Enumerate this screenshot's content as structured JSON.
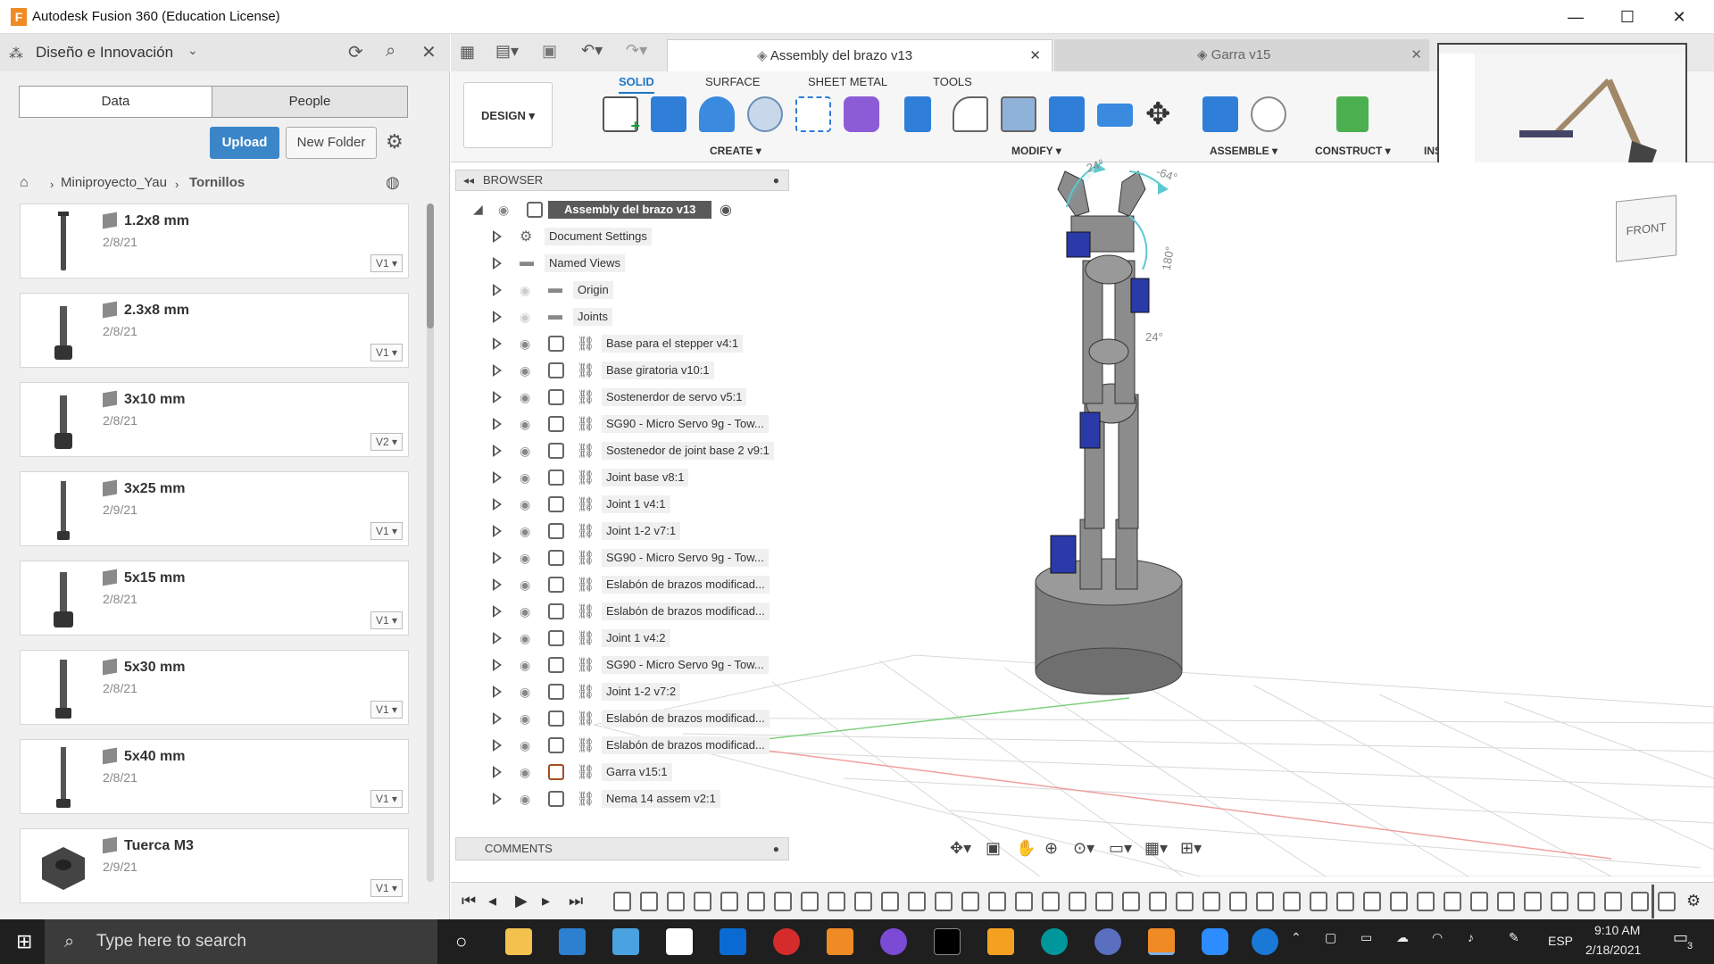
{
  "window": {
    "title": "Autodesk Fusion 360 (Education License)",
    "app_icon": "F",
    "controls": {
      "minimize": "—",
      "maximize": "☐",
      "close": "✕"
    }
  },
  "data_panel": {
    "hub": "Diseño e Innovación",
    "tabs": [
      "Data",
      "People"
    ],
    "upload_label": "Upload",
    "new_folder_label": "New Folder",
    "breadcrumb": [
      "Miniproyecto_Yau",
      "Tornillos"
    ],
    "files": [
      {
        "name": "1.2x8 mm",
        "date": "2/8/21",
        "version": "V1"
      },
      {
        "name": "2.3x8 mm",
        "date": "2/8/21",
        "version": "V1"
      },
      {
        "name": "3x10 mm",
        "date": "2/8/21",
        "version": "V2"
      },
      {
        "name": "3x25 mm",
        "date": "2/9/21",
        "version": "V1"
      },
      {
        "name": "5x15 mm",
        "date": "2/8/21",
        "version": "V1"
      },
      {
        "name": "5x30 mm",
        "date": "2/8/21",
        "version": "V1"
      },
      {
        "name": "5x40 mm",
        "date": "2/8/21",
        "version": "V1"
      },
      {
        "name": "Tuerca M3",
        "date": "2/9/21",
        "version": "V1"
      }
    ]
  },
  "doc_tabs": [
    {
      "label": "Assembly del brazo v13",
      "active": true
    },
    {
      "label": "Garra v15",
      "active": false
    }
  ],
  "ribbon": {
    "workspace": "DESIGN",
    "tabs": [
      "SOLID",
      "SURFACE",
      "SHEET METAL",
      "TOOLS"
    ],
    "groups": [
      "CREATE",
      "MODIFY",
      "ASSEMBLE",
      "CONSTRUCT",
      "INS"
    ]
  },
  "browser": {
    "header": "BROWSER",
    "root": "Assembly del brazo v13",
    "items": [
      "Document Settings",
      "Named Views",
      "Origin",
      "Joints",
      "Base para el stepper v4:1",
      "Base giratoria v10:1",
      "Sostenerdor de servo v5:1",
      "SG90 - Micro Servo 9g - Tow...",
      "Sostenedor de joint base 2 v9:1",
      "Joint base v8:1",
      "Joint 1 v4:1",
      "Joint 1-2 v7:1",
      "SG90 - Micro Servo 9g - Tow...",
      "Eslabón de brazos modificad...",
      "Eslabón de brazos modificad...",
      "Joint 1 v4:2",
      "SG90 - Micro Servo 9g - Tow...",
      "Joint 1-2 v7:2",
      "Eslabón de brazos modificad...",
      "Eslabón de brazos modificad...",
      "Garra v15:1",
      "Nema 14 assem v2:1"
    ],
    "comments": "COMMENTS"
  },
  "viewport": {
    "navcube_label": "FRONT",
    "angles": [
      "24°",
      "-64°",
      "180°",
      "24°"
    ]
  },
  "taskbar": {
    "search_placeholder": "Type here to search",
    "language": "ESP",
    "time": "9:10 AM",
    "date": "2/18/2021",
    "notifications": "3"
  },
  "colors": {
    "accent": "#1f76c6",
    "upload_button": "#3a86c8",
    "taskbar": "#1f1f1f",
    "servo_blue": "#2a3aa8",
    "arm_gray": "#8c8c8c"
  }
}
